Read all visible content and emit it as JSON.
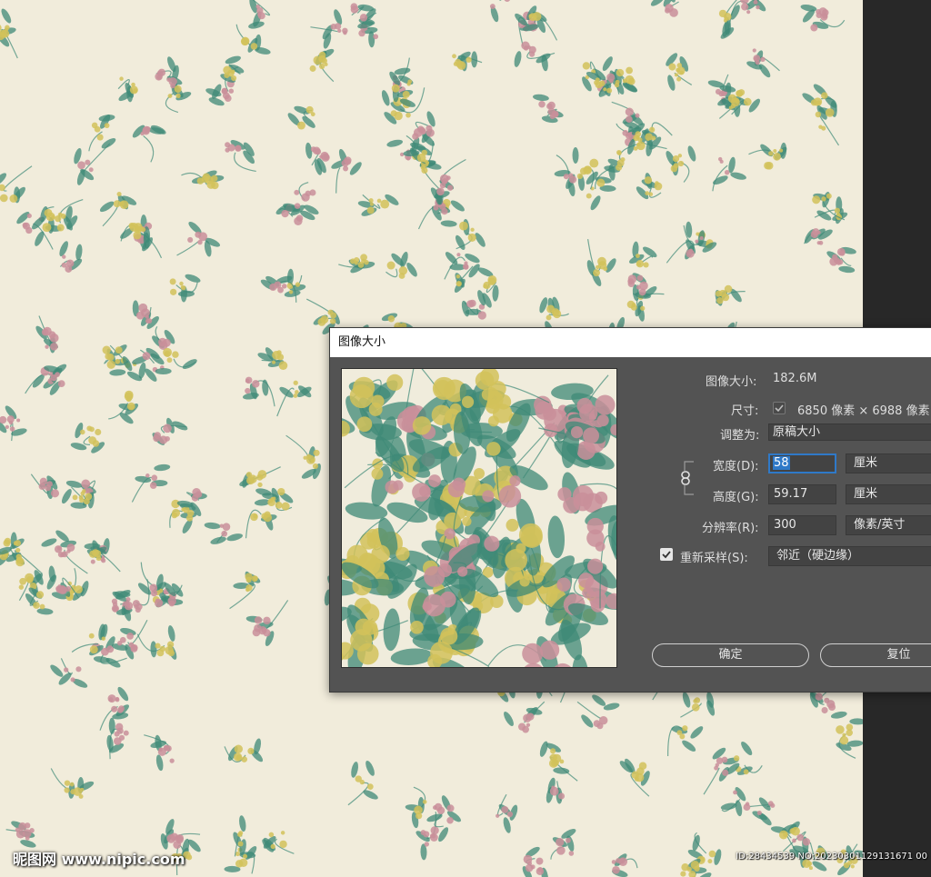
{
  "dialog": {
    "title": "图像大小",
    "image_size_label": "图像大小:",
    "image_size_value": "182.6M",
    "dimensions_label": "尺寸:",
    "dimensions_value": "6850 像素 × 6988 像素",
    "fit_to_label": "调整为:",
    "fit_to_value": "原稿大小",
    "width_label": "宽度(D):",
    "width_value": "58",
    "width_unit": "厘米",
    "height_label": "高度(G):",
    "height_value": "59.17",
    "height_unit": "厘米",
    "resolution_label": "分辨率(R):",
    "resolution_value": "300",
    "resolution_unit": "像素/英寸",
    "resample_label": "重新采样(S):",
    "resample_checked": true,
    "resample_value": "邻近（硬边缘）",
    "ok_label": "确定",
    "reset_label": "复位"
  },
  "watermark": {
    "site": "昵图网 www.nipic.com",
    "id_text": "ID:28434539 NO:20230301129131671 00"
  },
  "colors": {
    "canvas_bg": "#f1ecdb",
    "leaf": "#3f8a77",
    "pink": "#c98f9a",
    "yellow": "#d2c25a",
    "dialog_bg": "#535353",
    "accent": "#2f79c8"
  },
  "icons": [
    "checkbox-check-icon",
    "chain-link-icon"
  ]
}
